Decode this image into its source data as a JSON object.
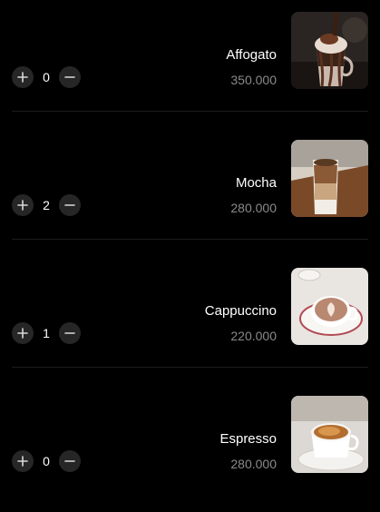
{
  "menu": {
    "items": [
      {
        "name": "Affogato",
        "price": "350.000",
        "quantity": "0"
      },
      {
        "name": "Mocha",
        "price": "280.000",
        "quantity": "2"
      },
      {
        "name": "Cappuccino",
        "price": "220.000",
        "quantity": "1"
      },
      {
        "name": "Espresso",
        "price": "280.000",
        "quantity": "0"
      }
    ]
  },
  "icons": {
    "increment": "plus-icon",
    "decrement": "minus-icon"
  },
  "colors": {
    "background": "#000000",
    "text_primary": "#ffffff",
    "text_price": "#8a8a8a",
    "button_bg": "#262626",
    "divider": "#1c1c1c"
  }
}
